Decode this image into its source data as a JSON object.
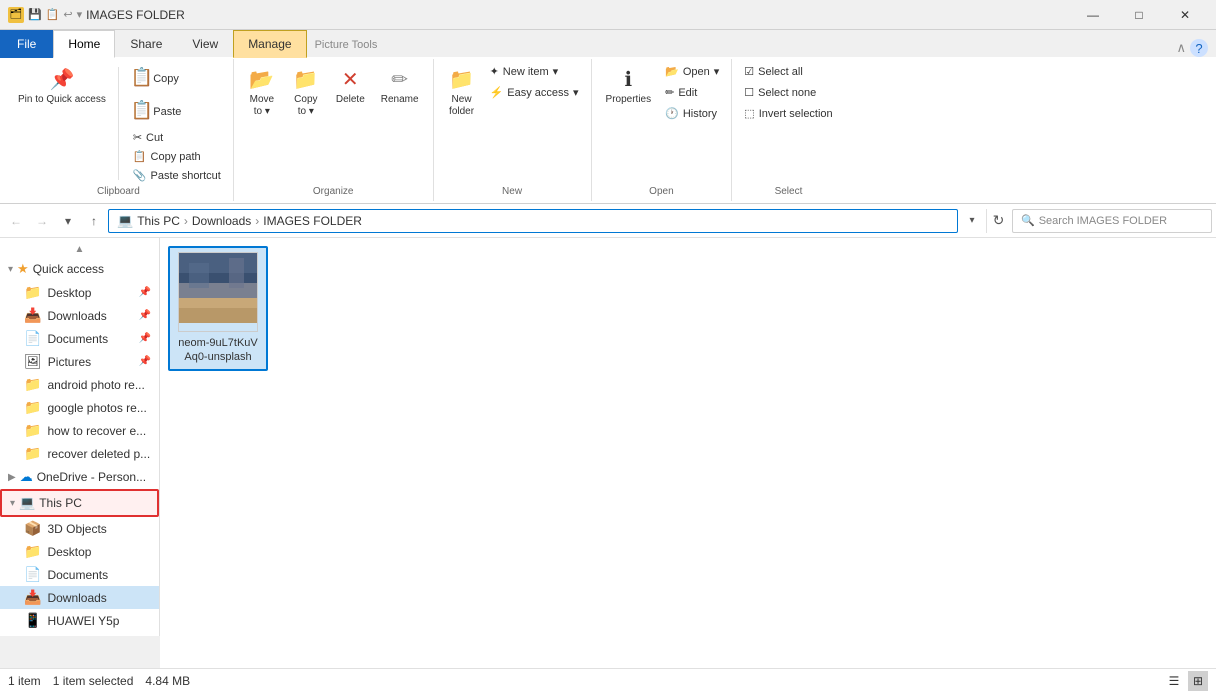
{
  "titleBar": {
    "title": "IMAGES FOLDER",
    "windowControls": {
      "minimize": "—",
      "maximize": "□",
      "close": "✕"
    }
  },
  "ribbonTabs": {
    "file": "File",
    "home": "Home",
    "share": "Share",
    "view": "View",
    "manage": "Manage",
    "manageSub": "Picture Tools"
  },
  "ribbon": {
    "clipboard": {
      "label": "Clipboard",
      "pinToQuickAccess": "Pin to Quick\naccess",
      "copy": "Copy",
      "paste": "Paste",
      "cut": "Cut",
      "copyPath": "Copy path",
      "pasteShortcut": "Paste shortcut"
    },
    "organize": {
      "label": "Organize",
      "moveTo": "Move\nto",
      "copyTo": "Copy\nto",
      "delete": "Delete",
      "rename": "Rename"
    },
    "new": {
      "label": "New",
      "newFolder": "New\nfolder",
      "newItem": "New item",
      "easyAccess": "Easy access"
    },
    "open": {
      "label": "Open",
      "properties": "Properties",
      "open": "Open",
      "edit": "Edit",
      "history": "History"
    },
    "select": {
      "label": "Select",
      "selectAll": "Select all",
      "selectNone": "Select none",
      "invertSelection": "Invert selection"
    }
  },
  "addressBar": {
    "breadcrumbs": [
      "This PC",
      "Downloads",
      "IMAGES FOLDER"
    ],
    "searchPlaceholder": "Search IMAGES FOLDER"
  },
  "sidebar": {
    "quickAccess": "Quick access",
    "items": [
      {
        "name": "Desktop",
        "pinned": true,
        "icon": "📁",
        "indent": 1
      },
      {
        "name": "Downloads",
        "pinned": true,
        "icon": "📥",
        "indent": 1
      },
      {
        "name": "Documents",
        "pinned": true,
        "icon": "📄",
        "indent": 1
      },
      {
        "name": "Pictures",
        "pinned": true,
        "icon": "🖼",
        "indent": 1
      },
      {
        "name": "android photo re...",
        "pinned": false,
        "icon": "📁",
        "indent": 1
      },
      {
        "name": "google photos re...",
        "pinned": false,
        "icon": "📁",
        "indent": 1
      },
      {
        "name": "how to recover e...",
        "pinned": false,
        "icon": "📁",
        "indent": 1
      },
      {
        "name": "recover deleted p...",
        "pinned": false,
        "icon": "📁",
        "indent": 1
      }
    ],
    "oneDrive": "OneDrive - Person...",
    "thisPC": "This PC",
    "thisPCItems": [
      {
        "name": "3D Objects",
        "icon": "📦",
        "indent": 2
      },
      {
        "name": "Desktop",
        "icon": "📁",
        "indent": 2
      },
      {
        "name": "Documents",
        "icon": "📄",
        "indent": 2
      },
      {
        "name": "Downloads",
        "icon": "📥",
        "indent": 2,
        "selected": true
      },
      {
        "name": "HUAWEI Y5p",
        "icon": "📱",
        "indent": 2
      }
    ]
  },
  "content": {
    "files": [
      {
        "name": "neom-9uL7tKuV\nAq0-unsplash",
        "type": "image",
        "selected": true
      }
    ]
  },
  "statusBar": {
    "itemCount": "1 item",
    "selectedCount": "1 item selected",
    "fileSize": "4.84 MB"
  }
}
